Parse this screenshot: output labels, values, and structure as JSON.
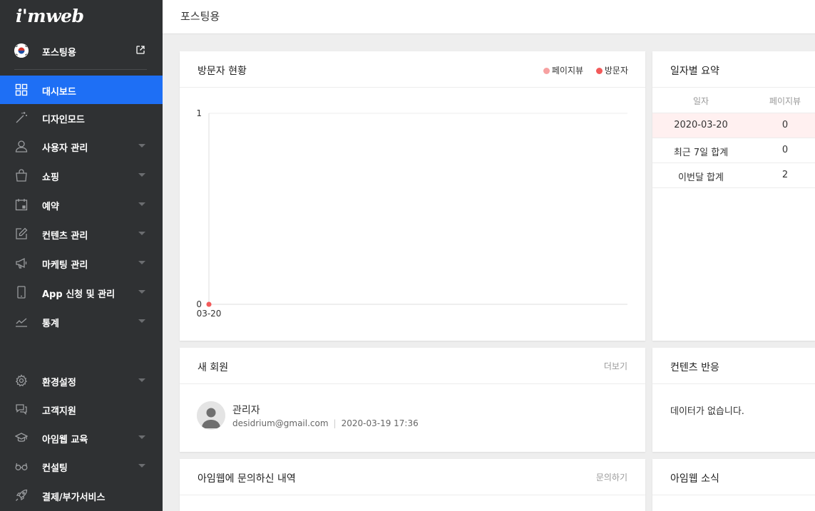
{
  "brand": {
    "logo": "i'mweb"
  },
  "site": {
    "name": "포스팅용"
  },
  "sidebar": {
    "items": [
      {
        "label": "대시보드",
        "icon": "grid-icon",
        "active": true,
        "caret": false
      },
      {
        "label": "디자인모드",
        "icon": "magic-wand-icon",
        "active": false,
        "caret": false
      },
      {
        "label": "사용자 관리",
        "icon": "user-icon",
        "active": false,
        "caret": true
      },
      {
        "label": "쇼핑",
        "icon": "shopping-bag-icon",
        "active": false,
        "caret": true
      },
      {
        "label": "예약",
        "icon": "calendar-icon",
        "active": false,
        "caret": true
      },
      {
        "label": "컨텐츠 관리",
        "icon": "edit-icon",
        "active": false,
        "caret": true
      },
      {
        "label": "마케팅 관리",
        "icon": "megaphone-icon",
        "active": false,
        "caret": true
      },
      {
        "label": "App 신청 및 관리",
        "icon": "mobile-icon",
        "active": false,
        "caret": true
      },
      {
        "label": "통계",
        "icon": "chart-line-icon",
        "active": false,
        "caret": true
      }
    ],
    "bottom_items": [
      {
        "label": "환경설정",
        "icon": "gear-icon",
        "caret": true
      },
      {
        "label": "고객지원",
        "icon": "chat-icon",
        "caret": false
      },
      {
        "label": "아임웹 교육",
        "icon": "graduation-cap-icon",
        "caret": true
      },
      {
        "label": "컨설팅",
        "icon": "glasses-icon",
        "caret": true
      },
      {
        "label": "결제/부가서비스",
        "icon": "rocket-icon",
        "caret": false
      }
    ]
  },
  "header": {
    "title": "포스팅용"
  },
  "visitors": {
    "title": "방문자 현황",
    "legend": [
      {
        "label": "페이지뷰",
        "color": "#f7a1a1"
      },
      {
        "label": "방문자",
        "color": "#f25a5a"
      }
    ]
  },
  "chart_data": {
    "type": "line",
    "x": [
      "03-20"
    ],
    "series": [
      {
        "name": "페이지뷰",
        "values": [
          0
        ],
        "color": "#f7a1a1"
      },
      {
        "name": "방문자",
        "values": [
          0
        ],
        "color": "#f25a5a"
      }
    ],
    "ylim": [
      0,
      1
    ],
    "yticks": [
      "0",
      "1"
    ],
    "legend": "top-right",
    "grid": true
  },
  "summary": {
    "title": "일자별 요약",
    "headers": [
      "일자",
      "페이지뷰"
    ],
    "rows": [
      [
        "2020-03-20",
        "0"
      ],
      [
        "최근 7일 합계",
        "0"
      ],
      [
        "이번달 합계",
        "2"
      ]
    ]
  },
  "new_members": {
    "title": "새 회원",
    "more": "더보기",
    "member": {
      "name": "관리자",
      "email": "desidrium@gmail.com",
      "joined": "2020-03-19 17:36"
    }
  },
  "content_reaction": {
    "title": "컨텐츠 반응",
    "empty": "데이터가 없습니다."
  },
  "inquiries": {
    "title": "아임웹에 문의하신 내역",
    "link": "문의하기"
  },
  "news": {
    "title": "아임웹 소식"
  },
  "colors": {
    "sidebar_bg": "#2f3133",
    "accent": "#1e6ff5"
  }
}
